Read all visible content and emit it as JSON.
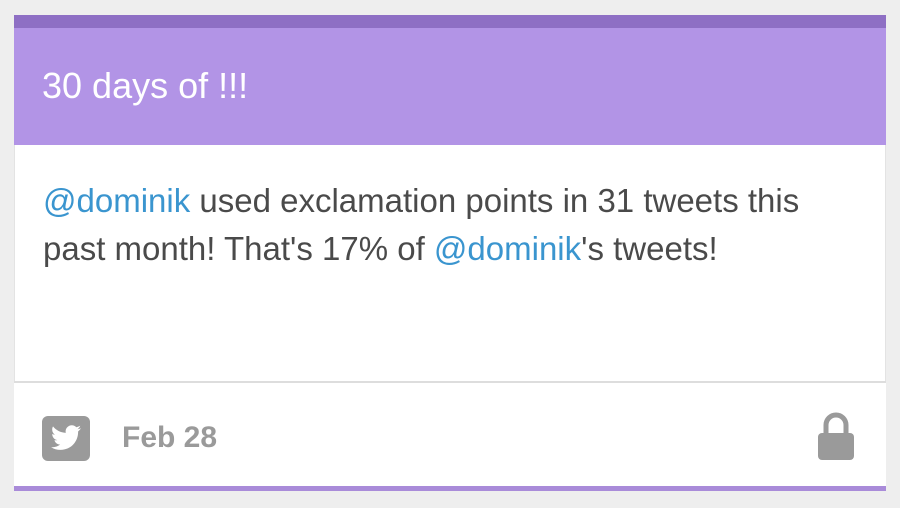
{
  "card": {
    "title": "30 days of !!!",
    "message": {
      "mention_1": "@dominik",
      "text_1": " used exclamation points in 31 tweets this past month! That's 17% of ",
      "mention_2": "@dominik",
      "text_2": "'s tweets!"
    },
    "footer": {
      "source_icon": "twitter-icon",
      "date": "Feb 28",
      "privacy_icon": "lock-icon"
    }
  },
  "colors": {
    "header_background": "#b294e6",
    "header_top_border": "#8e6fc4",
    "footer_bottom_border": "#a98bd9",
    "mention": "#3a95cf",
    "body_text": "#4a4a4a",
    "muted_gray": "#9a9a9a",
    "page_background": "#eeeeee"
  }
}
